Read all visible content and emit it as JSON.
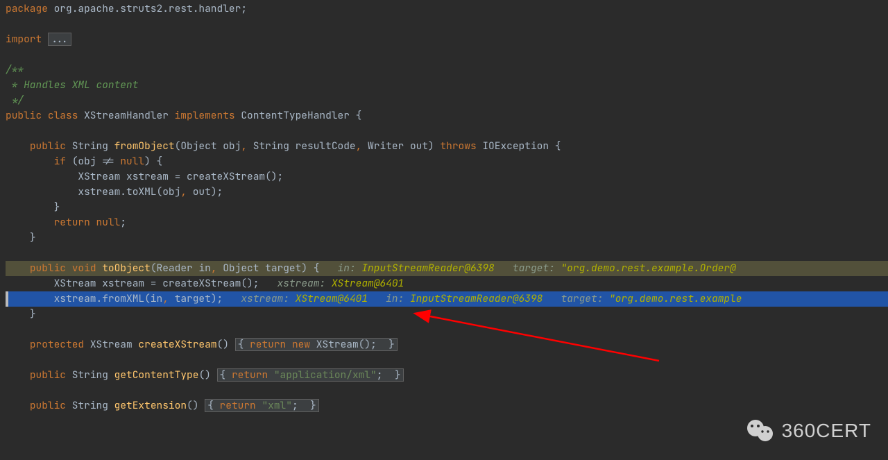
{
  "code": {
    "packageKw": "package ",
    "packageName": "org.apache.struts2.rest.handler",
    "semi": ";",
    "importKw": "import ",
    "importFold": "...",
    "docStart": "/**",
    "docLine": " * Handles XML content",
    "docEnd": " */",
    "publicKw": "public ",
    "classKw": "class ",
    "className": "XStreamHandler ",
    "implementsKw": "implements ",
    "interfaceName": "ContentTypeHandler ",
    "openBrace": "{",
    "closeBrace": "}",
    "indent1": "    ",
    "indent2": "        ",
    "indent3": "            ",
    "stringType": "String ",
    "fromObject": "fromObject",
    "fromObjectParams": "(Object obj",
    "comma": ", ",
    "strResultCode": "String resultCode",
    "writerOut": "Writer out) ",
    "throwsKw": "throws ",
    "ioException": "IOException ",
    "ifKw": "if ",
    "ifCond": "(obj != ",
    "nullKw": "null",
    "closeParen": ") ",
    "xstreamDecl": "XStream xstream = createXStream()",
    "xstreamToXML": "xstream.toXML(obj",
    "outParam": "out)",
    "returnKw": "return ",
    "voidKw": "void ",
    "toObject": "toObject",
    "toObjectParams": "(Reader in",
    "objectTarget": "Object target) ",
    "fromXML": "xstream.fromXML(in",
    "targetParam": "target)",
    "protectedKw": "protected ",
    "xstreamType": "XStream ",
    "createXStream": "createXStream",
    "emptyParens": "() ",
    "newKw": "new ",
    "xstreamCtor": "XStream()",
    "getContentType": "getContentType",
    "appXml": "\"application/xml\"",
    "getExtension": "getExtension",
    "xmlStr": "\"xml\"",
    "foldOpen": "{ ",
    "foldClose": " }",
    "spaceSemi": "; "
  },
  "debug": {
    "inLabel": "in: ",
    "inVal1": "InputStreamReader@6398",
    "targetLabel": "target: ",
    "targetVal1": "\"org.demo.rest.example.Order@",
    "xstreamLabel": "xstream: ",
    "xstreamVal": "XStream@6401",
    "inVal2": "InputStreamReader@6398",
    "targetVal2": "\"org.demo.rest.example"
  },
  "watermark": {
    "text": "360CERT"
  }
}
